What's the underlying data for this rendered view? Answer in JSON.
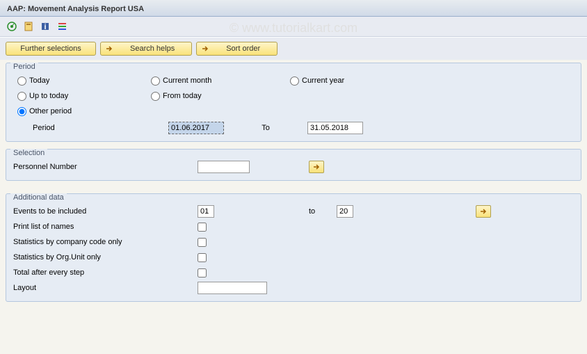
{
  "title": "AAP: Movement Analysis Report USA",
  "watermark": "© www.tutorialkart.com",
  "toolbar": {
    "icons": {
      "execute": "execute",
      "variant": "variant",
      "info": "info",
      "tree": "tree"
    }
  },
  "buttons": {
    "further_selections": "Further selections",
    "search_helps": "Search helps",
    "sort_order": "Sort order"
  },
  "period": {
    "group_label": "Period",
    "today": "Today",
    "current_month": "Current month",
    "current_year": "Current year",
    "up_to_today": "Up to today",
    "from_today": "From today",
    "other_period": "Other period",
    "period_label": "Period",
    "start_date": "01.06.2017",
    "to_label": "To",
    "end_date": "31.05.2018",
    "selected": "other_period"
  },
  "selection": {
    "group_label": "Selection",
    "personnel_number_label": "Personnel Number",
    "personnel_number_value": ""
  },
  "additional": {
    "group_label": "Additional data",
    "events_label": "Events to be included",
    "events_from": "01",
    "events_to_label": "to",
    "events_to": "20",
    "print_names_label": "Print list of names",
    "print_names": false,
    "stats_company_label": "Statistics by company code only",
    "stats_company": false,
    "stats_org_label": "Statistics by Org.Unit only",
    "stats_org": false,
    "total_step_label": "Total after every step",
    "total_step": false,
    "layout_label": "Layout",
    "layout_value": ""
  }
}
